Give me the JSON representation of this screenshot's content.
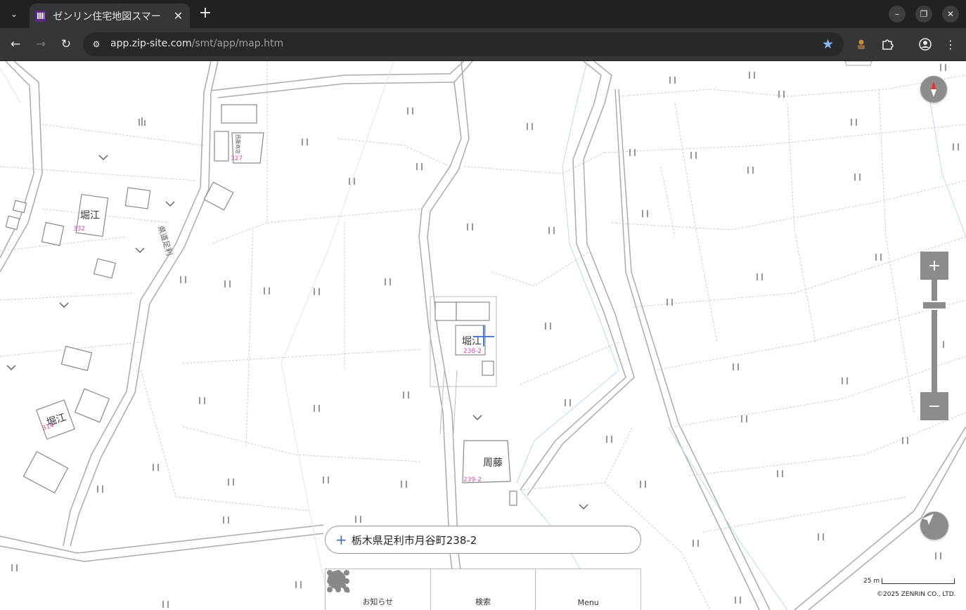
{
  "browser": {
    "tab_title": "ゼンリン住宅地図スマー",
    "url_host": "app.zip-site.com",
    "url_path": "/smt/app/map.htm"
  },
  "map": {
    "road_name": "県道足利",
    "labels": [
      {
        "name": "堀江",
        "num": "332"
      },
      {
        "name": "堀江",
        "num": "314"
      },
      {
        "name": "堀江",
        "num": "238-2"
      },
      {
        "name": "周藤",
        "num": "239-2"
      }
    ],
    "small_label_num": "327",
    "scale_text": "25 m",
    "copyright": "©2025 ZENRIN CO., LTD."
  },
  "address_bar": {
    "text": "栃木県足利市月谷町238-2"
  },
  "bottom_nav": [
    {
      "label": "お知らせ",
      "icon": "bell-icon"
    },
    {
      "label": "検索",
      "icon": "search-icon"
    },
    {
      "label": "Menu",
      "icon": "grid-menu-icon"
    }
  ],
  "colors": {
    "house_number": "#d04fb0",
    "crosshair": "#4f7bd3",
    "map_control": "#8c8c8c",
    "chrome_bg": "#202124"
  }
}
